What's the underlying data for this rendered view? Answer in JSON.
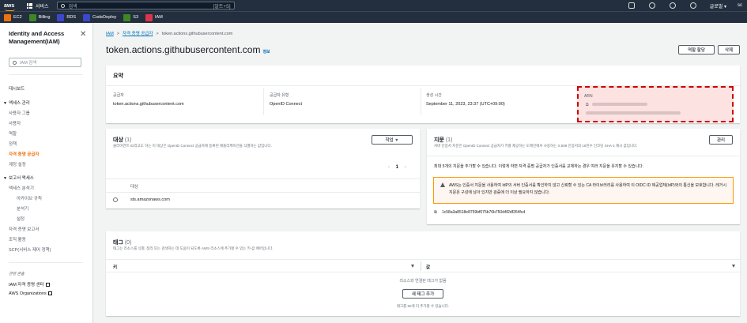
{
  "topnav": {
    "logo": "aws",
    "services": "서비스",
    "search_placeholder": "검색",
    "search_shortcut": "[알트+S]",
    "region": "글로벌 ▾",
    "account": "sc",
    "icons": [
      "cloudshell-icon",
      "bell-icon",
      "help-icon",
      "settings-icon"
    ]
  },
  "favorites": [
    {
      "label": "EC2",
      "color": "#ec7211"
    },
    {
      "label": "Billing",
      "color": "#3f8624"
    },
    {
      "label": "RDS",
      "color": "#3b48cc"
    },
    {
      "label": "CodeDeploy",
      "color": "#3b48cc"
    },
    {
      "label": "S3",
      "color": "#3f8624"
    },
    {
      "label": "IAM",
      "color": "#dd344c"
    }
  ],
  "sidebar": {
    "title": "Identity and Access Management(IAM)",
    "search_placeholder": "IAM 검색",
    "dashboard": "대시보드",
    "access_mgmt": "액세스 관리",
    "items": [
      "사용자 그룹",
      "사용자",
      "역할",
      "정책",
      "자격 증명 공급자",
      "계정 설정"
    ],
    "access_reports": "보고서 액세스",
    "analyzer": "액세스 분석기",
    "analyzer_items": [
      "아카이브 규칙",
      "분석기",
      "설정"
    ],
    "cred_report": "자격 증명 보고서",
    "org_activity": "조직 활동",
    "scp": "SCP(서비스 제어 정책)",
    "related": "관련 콘솔",
    "iam_center": "IAM 자격 증명 센터",
    "aws_orgs": "AWS Organizations"
  },
  "breadcrumb": {
    "root": "IAM",
    "parent": "자격 증명 공급자",
    "current": "token.actions.githubusercontent.com"
  },
  "page": {
    "title": "token.actions.githubusercontent.com",
    "info": "정보",
    "assign_role": "역할 할당",
    "delete": "삭제"
  },
  "summary": {
    "heading": "요약",
    "provider_label": "공급자",
    "provider_value": "token.actions.githubusercontent.com",
    "type_label": "공급자 유형",
    "type_value": "OpenID Connect",
    "created_label": "생성 시간",
    "created_value": "September 11, 2023, 23:37 (UTC+09:00)",
    "arn_label": "ARN",
    "highlight_color": "#cc0000"
  },
  "audience": {
    "heading": "대상",
    "count": "(1)",
    "desc": "클라이언트 ID라고도 하는 이 대상은 OpenID Connect 공급자에 등록된 애플리케이션을 식별하는 값입니다.",
    "actions": "작업 ▼",
    "page": "1",
    "col": "대상",
    "rows": [
      "sts.amazonaws.com"
    ]
  },
  "thumbprint": {
    "heading": "지문",
    "count": "(1)",
    "desc": "서버 인증서 지문은 OpenID Connect 공급자가 키를 제공하는 도메인에서 사용하는 X.509 인증서의 16진수 인코딩 SHA-1 해시 값입니다.",
    "manage": "관리",
    "note": "최대 5개의 지문을 추가할 수 있습니다. 이렇게 하면 자격 증명 공급자가 인증서를 교체하는 경우 여러 지문을 유지할 수 있습니다.",
    "warning": "AWS는 인증서 지문을 사용하여 IdP의 서버 인증서를 확인하지 않고 신뢰할 수 있는 CA 라이브러리를 사용하여 이 OIDC ID 제공업체(IdP)와의 통신을 보호합니다. 레거시 지문은 구성에 남아 있지만 검증에 더 이상 필요하지 않습니다.",
    "value": "1c58a3a8518e8759bf075b76b750d4f2df264fcd"
  },
  "tags": {
    "heading": "태그",
    "count": "(0)",
    "desc": "태그는 리소스를 식별, 정리 또는 검색하는 데 도움이 되도록 AWS 리소스에 추가할 수 있는 키-값 페어입니다.",
    "key_col": "키",
    "value_col": "값",
    "empty": "리소스와 연결된 태그가 없음",
    "add_button": "새 태그 추가",
    "limit": "태그를 50개 더 추가할 수 있습니다."
  }
}
